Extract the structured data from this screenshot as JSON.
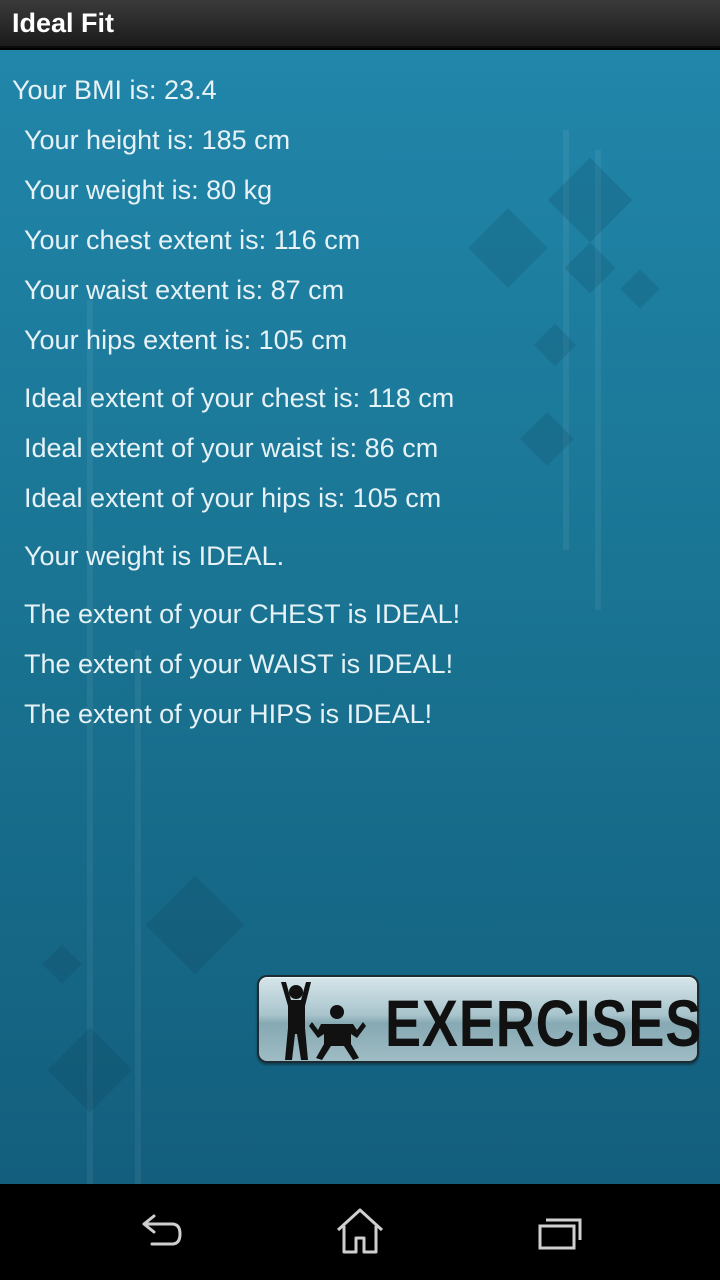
{
  "app": {
    "title": "Ideal Fit"
  },
  "results": {
    "bmi": "Your BMI is: 23.4",
    "height": "Your height is: 185 cm",
    "weight": "Your weight is: 80 kg",
    "chest": "Your chest extent is: 116 cm",
    "waist": "Your waist extent is: 87 cm",
    "hips": "Your hips extent is: 105 cm",
    "ideal_chest": "Ideal extent of your chest is: 118 cm",
    "ideal_waist": "Ideal extent of your waist is: 86 cm",
    "ideal_hips": "Ideal extent of your hips is: 105 cm",
    "weight_verdict": "Your weight is IDEAL.",
    "chest_verdict": "The extent of your CHEST is IDEAL!",
    "waist_verdict": "The extent of your WAIST is IDEAL!",
    "hips_verdict": "The extent of your HIPS is IDEAL!"
  },
  "exercises_button": {
    "label": "EXERCISES",
    "icon": "exercise-figures-icon"
  },
  "navbar": {
    "back_icon": "back-icon",
    "home_icon": "home-icon",
    "recents_icon": "recent-apps-icon"
  },
  "colors": {
    "background_top": "#2186aa",
    "background_bottom": "#135e7d",
    "text": "#e6f2f6"
  }
}
